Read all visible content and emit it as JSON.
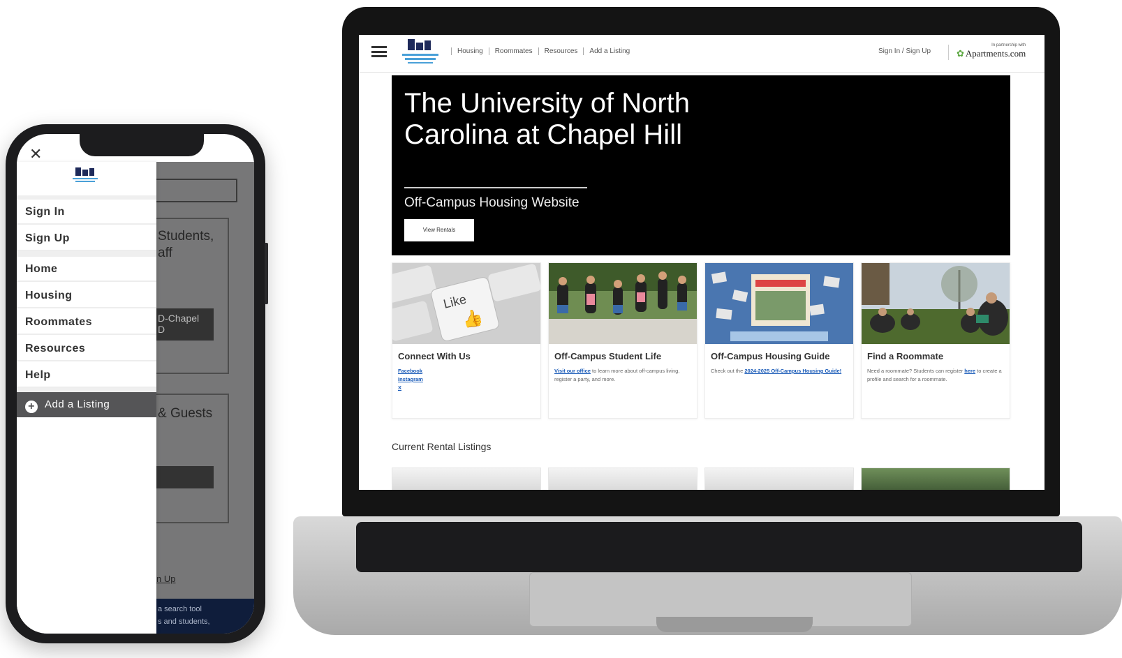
{
  "phone": {
    "close_icon": "close-icon",
    "logo_icon": "off-campus-logo-icon",
    "menu_primary": [
      "Sign In",
      "Sign Up"
    ],
    "menu_secondary": [
      "Home",
      "Housing",
      "Roommates",
      "Resources",
      "Help"
    ],
    "add_listing": "Add a Listing",
    "background_text": {
      "heading1_line1": "Students,",
      "heading1_line2": "aff",
      "button1_line1": "D-Chapel",
      "button1_line2": "D",
      "heading2": "& Guests",
      "link": "n Up",
      "footer_line1": "a search tool",
      "footer_line2": "s and students,"
    }
  },
  "site": {
    "logo_icon": "off-campus-student-life-logo-icon",
    "nav": [
      "Housing",
      "Roommates",
      "Resources",
      "Add a Listing"
    ],
    "signin": "Sign In / Sign Up",
    "partner_small": "In partnership with",
    "partner_name": "Apartments.com",
    "hero": {
      "title": "The University of North Carolina at Chapel Hill",
      "subtitle": "Off-Campus Housing Website",
      "button": "View Rentals"
    },
    "cards": [
      {
        "title": "Connect With Us",
        "links": [
          "Facebook",
          "Instagram",
          "X"
        ]
      },
      {
        "title": "Off-Campus Student Life",
        "link": "Visit our office",
        "text": " to learn more about off-campus living, register a party, and more."
      },
      {
        "title": "Off-Campus Housing Guide",
        "text": "Check out the ",
        "link": "2024-2025 Off-Campus Housing Guide!"
      },
      {
        "title": "Find a Roommate",
        "text": "Need a roommate? Students can register ",
        "link": "here",
        "text2": " to create a profile and search for a roommate."
      }
    ],
    "section_title": "Current Rental Listings"
  },
  "colors": {
    "hero_bg": "#000000",
    "link": "#1a5bb8",
    "drawer_active": "#555557",
    "phone_overlay": "#777778"
  }
}
